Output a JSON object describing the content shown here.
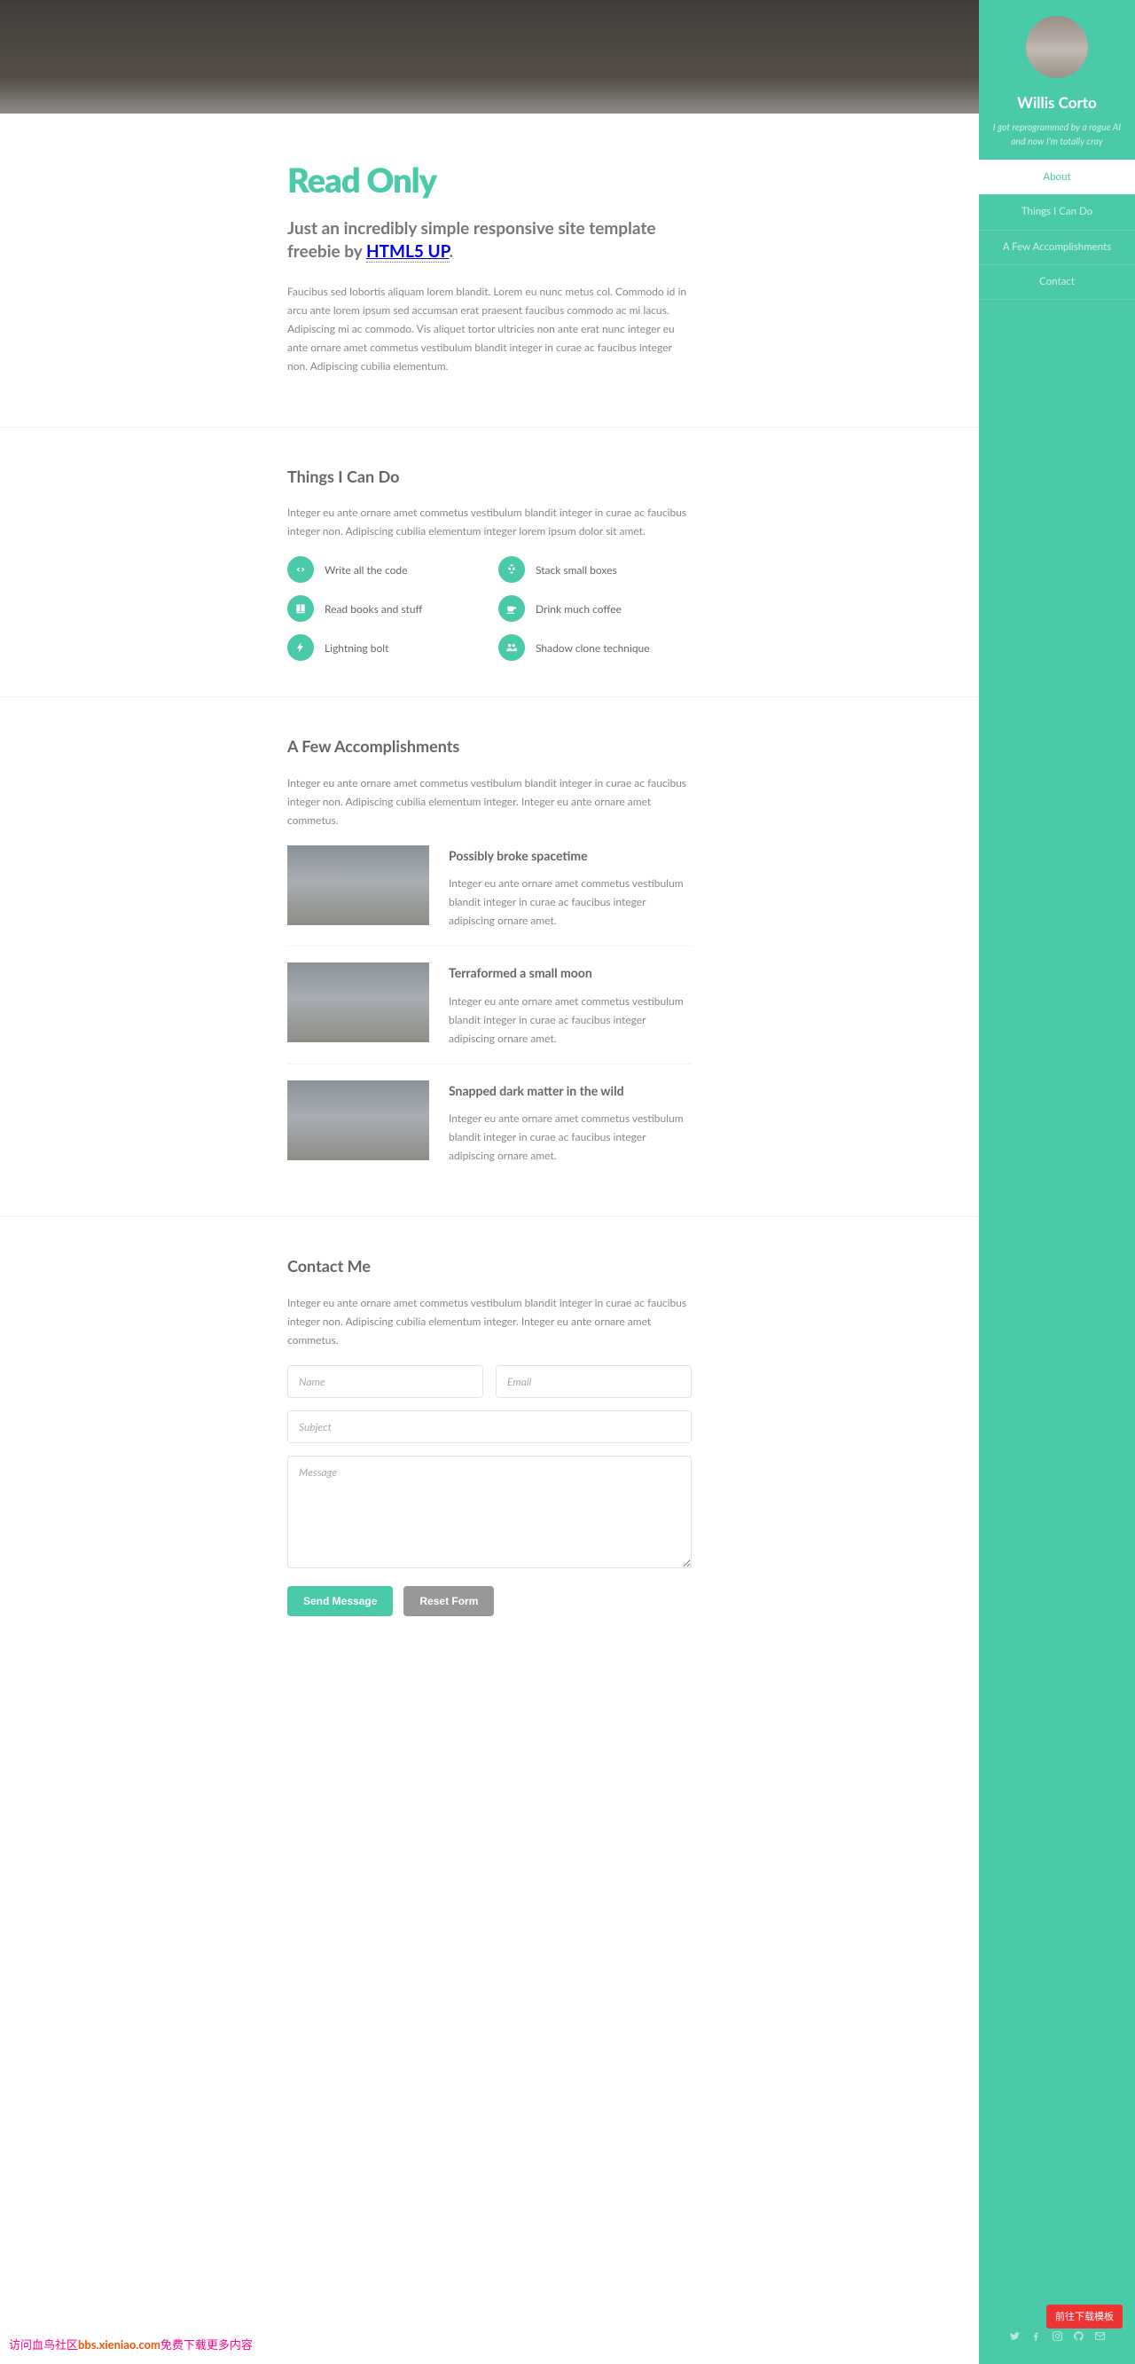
{
  "header": {
    "name": "Willis Corto",
    "tagline1": "I got reprogrammed by a rogue AI",
    "tagline2": "and now I'm totally cray"
  },
  "nav": {
    "items": [
      {
        "label": "About",
        "active": true
      },
      {
        "label": "Things I Can Do",
        "active": false
      },
      {
        "label": "A Few Accomplishments",
        "active": false
      },
      {
        "label": "Contact",
        "active": false
      }
    ]
  },
  "about": {
    "title": "Read Only",
    "subtitle_pre": "Just an incredibly simple responsive site template freebie by ",
    "subtitle_link": "HTML5 UP",
    "subtitle_post": ".",
    "body": "Faucibus sed lobortis aliquam lorem blandit. Lorem eu nunc metus col. Commodo id in arcu ante lorem ipsum sed accumsan erat praesent faucibus commodo ac mi lacus. Adipiscing mi ac commodo. Vis aliquet tortor ultricies non ante erat nunc integer eu ante ornare amet commetus vestibulum blandit integer in curae ac faucibus integer non. Adipiscing cubilia elementum."
  },
  "things": {
    "title": "Things I Can Do",
    "intro": "Integer eu ante ornare amet commetus vestibulum blandit integer in curae ac faucibus integer non. Adipiscing cubilia elementum integer lorem ipsum dolor sit amet.",
    "items": [
      {
        "icon": "code",
        "label": "Write all the code"
      },
      {
        "icon": "cubes",
        "label": "Stack small boxes"
      },
      {
        "icon": "book",
        "label": "Read books and stuff"
      },
      {
        "icon": "coffee",
        "label": "Drink much coffee"
      },
      {
        "icon": "bolt",
        "label": "Lightning bolt"
      },
      {
        "icon": "users",
        "label": "Shadow clone technique"
      }
    ]
  },
  "accomplishments": {
    "title": "A Few Accomplishments",
    "intro": "Integer eu ante ornare amet commetus vestibulum blandit integer in curae ac faucibus integer non. Adipiscing cubilia elementum integer. Integer eu ante ornare amet commetus.",
    "items": [
      {
        "title": "Possibly broke spacetime",
        "body": "Integer eu ante ornare amet commetus vestibulum blandit integer in curae ac faucibus integer adipiscing ornare amet."
      },
      {
        "title": "Terraformed a small moon",
        "body": "Integer eu ante ornare amet commetus vestibulum blandit integer in curae ac faucibus integer adipiscing ornare amet."
      },
      {
        "title": "Snapped dark matter in the wild",
        "body": "Integer eu ante ornare amet commetus vestibulum blandit integer in curae ac faucibus integer adipiscing ornare amet."
      }
    ]
  },
  "contact": {
    "title": "Contact Me",
    "intro": "Integer eu ante ornare amet commetus vestibulum blandit integer in curae ac faucibus integer non. Adipiscing cubilia elementum integer. Integer eu ante ornare amet commetus.",
    "placeholders": {
      "name": "Name",
      "email": "Email",
      "subject": "Subject",
      "message": "Message"
    },
    "submit": "Send Message",
    "reset": "Reset Form"
  },
  "footer": {
    "icons": [
      "twitter",
      "facebook",
      "instagram",
      "github",
      "envelope"
    ]
  },
  "overlay": {
    "red_button": "前往下载模板",
    "bottom_text_pre": "访问血鸟社区",
    "bottom_text_url": "bbs.xieniao.com",
    "bottom_text_post": "免费下载更多内容"
  }
}
